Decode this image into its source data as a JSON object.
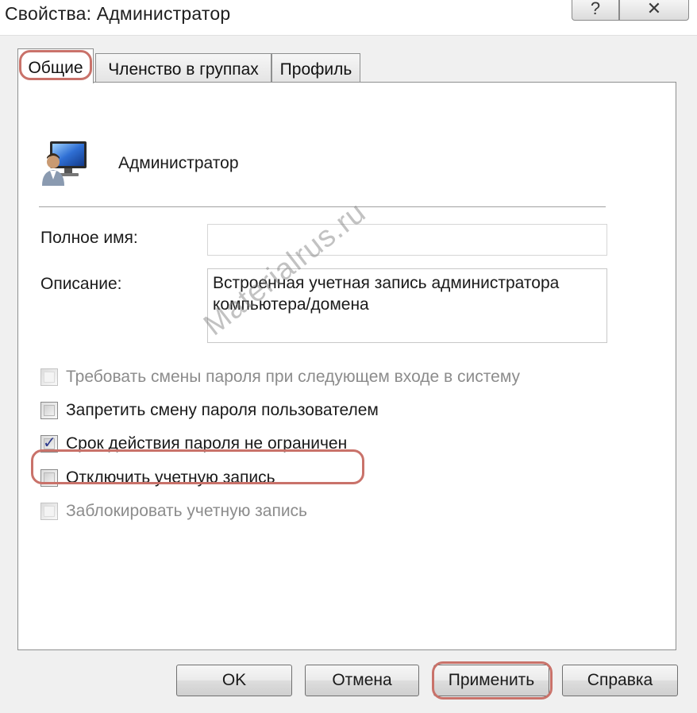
{
  "window": {
    "title": "Свойства: Администратор",
    "help_glyph": "?",
    "close_glyph": "✕"
  },
  "tabs": [
    {
      "label": "Общие",
      "selected": true
    },
    {
      "label": "Членство в группах",
      "selected": false
    },
    {
      "label": "Профиль",
      "selected": false
    }
  ],
  "general": {
    "user_name": "Администратор",
    "full_name_label": "Полное имя:",
    "full_name_value": "",
    "description_label": "Описание:",
    "description_value": "Встроенная учетная запись администратора компьютера/домена"
  },
  "options": [
    {
      "label": "Требовать смены пароля при следующем входе в систему",
      "checked": false,
      "enabled": false
    },
    {
      "label": "Запретить смену пароля пользователем",
      "checked": false,
      "enabled": true
    },
    {
      "label": "Срок действия пароля не ограничен",
      "checked": true,
      "enabled": true
    },
    {
      "label": "Отключить учетную запись",
      "checked": false,
      "enabled": true
    },
    {
      "label": "Заблокировать учетную запись",
      "checked": false,
      "enabled": false
    }
  ],
  "buttons": {
    "ok": "OK",
    "cancel": "Отмена",
    "apply": "Применить",
    "help": "Справка"
  },
  "watermark": "Materialrus.ru",
  "colors": {
    "highlight": "#c9726a",
    "dialog_bg": "#f0f0f0",
    "check": "#2d3a8c"
  },
  "icons": {
    "user": "user-computer-icon",
    "help": "question-mark-icon",
    "close": "close-icon"
  }
}
